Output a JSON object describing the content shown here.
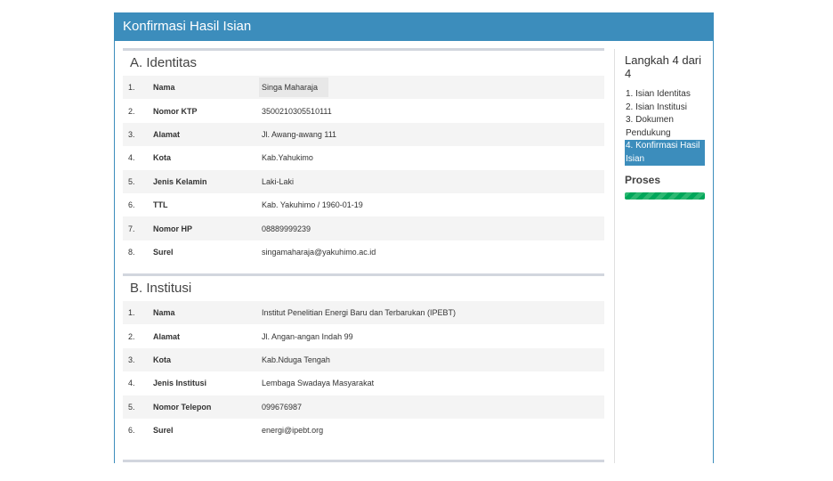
{
  "header": {
    "title": "Konfirmasi Hasil Isian"
  },
  "identitas": {
    "title": "A. Identitas",
    "rows": [
      {
        "num": "1.",
        "label": "Nama",
        "value": "Singa Maharaja"
      },
      {
        "num": "2.",
        "label": "Nomor KTP",
        "value": "3500210305510111"
      },
      {
        "num": "3.",
        "label": "Alamat",
        "value": "Jl. Awang-awang 111"
      },
      {
        "num": "4.",
        "label": "Kota",
        "value": "Kab.Yahukimo"
      },
      {
        "num": "5.",
        "label": "Jenis Kelamin",
        "value": "Laki-Laki"
      },
      {
        "num": "6.",
        "label": "TTL",
        "value": "Kab. Yakuhimo / 1960-01-19"
      },
      {
        "num": "7.",
        "label": "Nomor HP",
        "value": "08889999239"
      },
      {
        "num": "8.",
        "label": "Surel",
        "value": "singamaharaja@yakuhimo.ac.id"
      }
    ]
  },
  "institusi": {
    "title": "B. Institusi",
    "rows": [
      {
        "num": "1.",
        "label": "Nama",
        "value": "Institut Penelitian Energi Baru dan Terbarukan (IPEBT)"
      },
      {
        "num": "2.",
        "label": "Alamat",
        "value": "Jl. Angan-angan Indah 99"
      },
      {
        "num": "3.",
        "label": "Kota",
        "value": "Kab.Nduga Tengah"
      },
      {
        "num": "4.",
        "label": "Jenis Institusi",
        "value": "Lembaga Swadaya Masyarakat"
      },
      {
        "num": "5.",
        "label": "Nomor Telepon",
        "value": "099676987"
      },
      {
        "num": "6.",
        "label": "Surel",
        "value": "energi@ipebt.org"
      }
    ]
  },
  "sidebar": {
    "step_title": "Langkah 4 dari 4",
    "steps": [
      {
        "label": "1. Isian Identitas",
        "active": false
      },
      {
        "label": "2. Isian Institusi",
        "active": false
      },
      {
        "label": "3. Dokumen Pendukung",
        "active": false
      },
      {
        "label": "4. Konfirmasi Hasil Isian",
        "active": true
      }
    ],
    "proses_label": "Proses",
    "progress_percent": 100,
    "progress_color": "#00a65a"
  },
  "colors": {
    "primary": "#3c8dbc",
    "success": "#00a65a"
  }
}
